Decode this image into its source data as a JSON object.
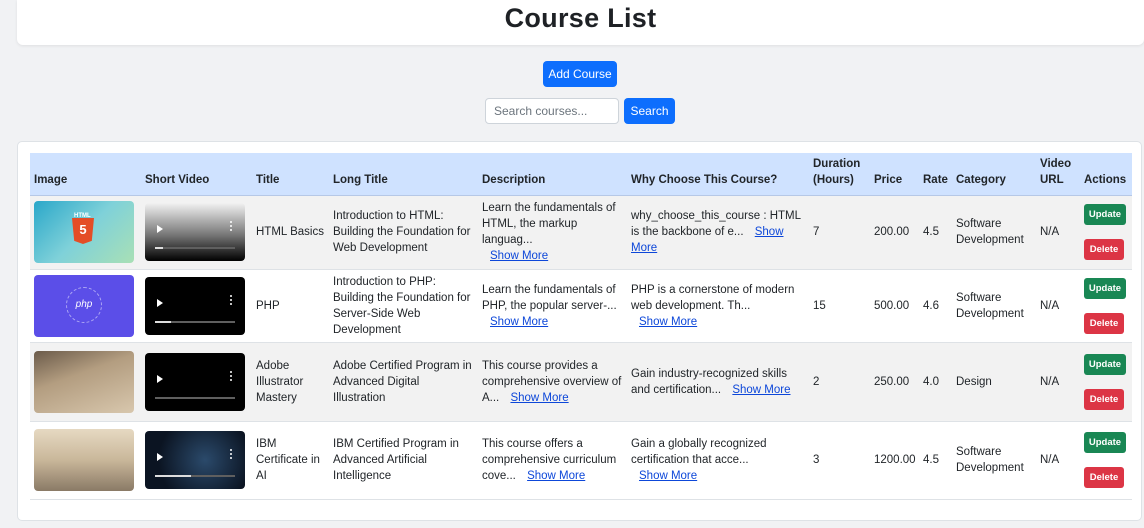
{
  "page": {
    "title": "Course List"
  },
  "toolbar": {
    "add_label": "Add Course",
    "search_placeholder": "Search courses...",
    "search_label": "Search"
  },
  "table": {
    "headers": {
      "image": "Image",
      "short_video": "Short Video",
      "title": "Title",
      "long_title": "Long Title",
      "description": "Description",
      "why": "Why Choose This Course?",
      "duration": "Duration (Hours)",
      "price": "Price",
      "rate": "Rate",
      "category": "Category",
      "video_url": "Video URL",
      "actions": "Actions"
    },
    "show_more_label": "Show More",
    "update_label": "Update",
    "delete_label": "Delete",
    "rows": [
      {
        "title": "HTML Basics",
        "long_title": "Introduction to HTML: Building the Foundation for Web Development",
        "description": "Learn the fundamentals of HTML, the markup languag...",
        "why": "why_choose_this_course : HTML is the backbone of e...",
        "duration": "7",
        "price": "200.00",
        "rate": "4.5",
        "category": "Software Development",
        "video_url": "N/A",
        "image_icon": "html5-icon",
        "video_progress": 0.1
      },
      {
        "title": "PHP",
        "long_title": "Introduction to PHP: Building the Foundation for Server-Side Web Development",
        "description": "Learn the fundamentals of PHP, the popular server-...",
        "why": "PHP is a cornerstone of modern web development. Th...",
        "duration": "15",
        "price": "500.00",
        "rate": "4.6",
        "category": "Software Development",
        "video_url": "N/A",
        "image_icon": "php-icon",
        "video_progress": 0.2
      },
      {
        "title": "Adobe Illustrator Mastery",
        "long_title": "Adobe Certified Program in Advanced Digital Illustration",
        "description": "This course provides a comprehensive overview of A...",
        "why": "Gain industry-recognized skills and certification...",
        "duration": "2",
        "price": "250.00",
        "rate": "4.0",
        "category": "Design",
        "video_url": "N/A",
        "image_icon": "desk-photo",
        "video_progress": 0.0
      },
      {
        "title": "IBM Certificate in AI",
        "long_title": "IBM Certified Program in Advanced Artificial Intelligence",
        "description": "This course offers a comprehensive curriculum cove...",
        "why": "Gain a globally recognized certification that acce...",
        "duration": "3",
        "price": "1200.00",
        "rate": "4.5",
        "category": "Software Development",
        "video_url": "N/A",
        "image_icon": "meeting-photo",
        "video_progress": 0.45
      }
    ]
  }
}
